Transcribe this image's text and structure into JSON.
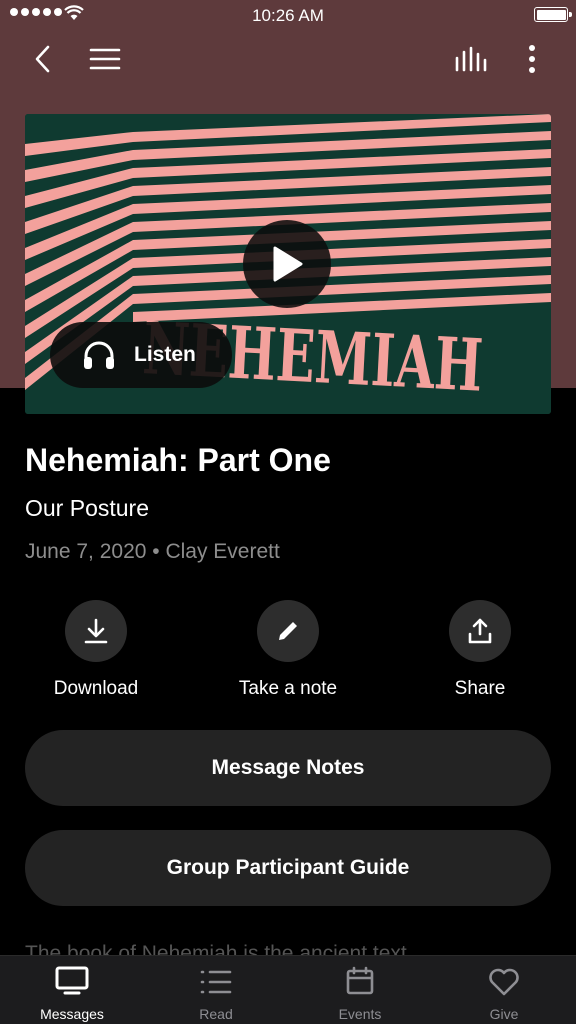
{
  "status_bar": {
    "time": "10:26 AM"
  },
  "nav": {
    "icons": [
      "back-chevron-icon",
      "menu-icon",
      "audio-bars-icon",
      "more-vertical-icon"
    ]
  },
  "artwork": {
    "title_text": "NEHEMIAH",
    "colors": {
      "background": "#0f3a30",
      "stripes": "#f3a19c"
    },
    "listen_label": "Listen"
  },
  "message": {
    "title": "Nehemiah: Part One",
    "subtitle": "Our Posture",
    "meta": "June 7, 2020 • Clay Everett"
  },
  "actions": [
    {
      "label": "Download",
      "icon": "download-icon"
    },
    {
      "label": "Take a note",
      "icon": "pencil-icon"
    },
    {
      "label": "Share",
      "icon": "share-icon"
    }
  ],
  "buttons": {
    "message_notes": "Message Notes",
    "group_guide": "Group Participant Guide"
  },
  "body_preview": "The book of Nehemiah is the ancient text",
  "tabbar": {
    "tabs": [
      {
        "label": "Messages",
        "icon": "monitor-icon",
        "active": true
      },
      {
        "label": "Read",
        "icon": "list-icon",
        "active": false
      },
      {
        "label": "Events",
        "icon": "calendar-icon",
        "active": false
      },
      {
        "label": "Give",
        "icon": "heart-icon",
        "active": false
      }
    ]
  },
  "colors": {
    "header": "#5e3a3c",
    "surface": "#232323",
    "muted": "#8d8d8d"
  }
}
